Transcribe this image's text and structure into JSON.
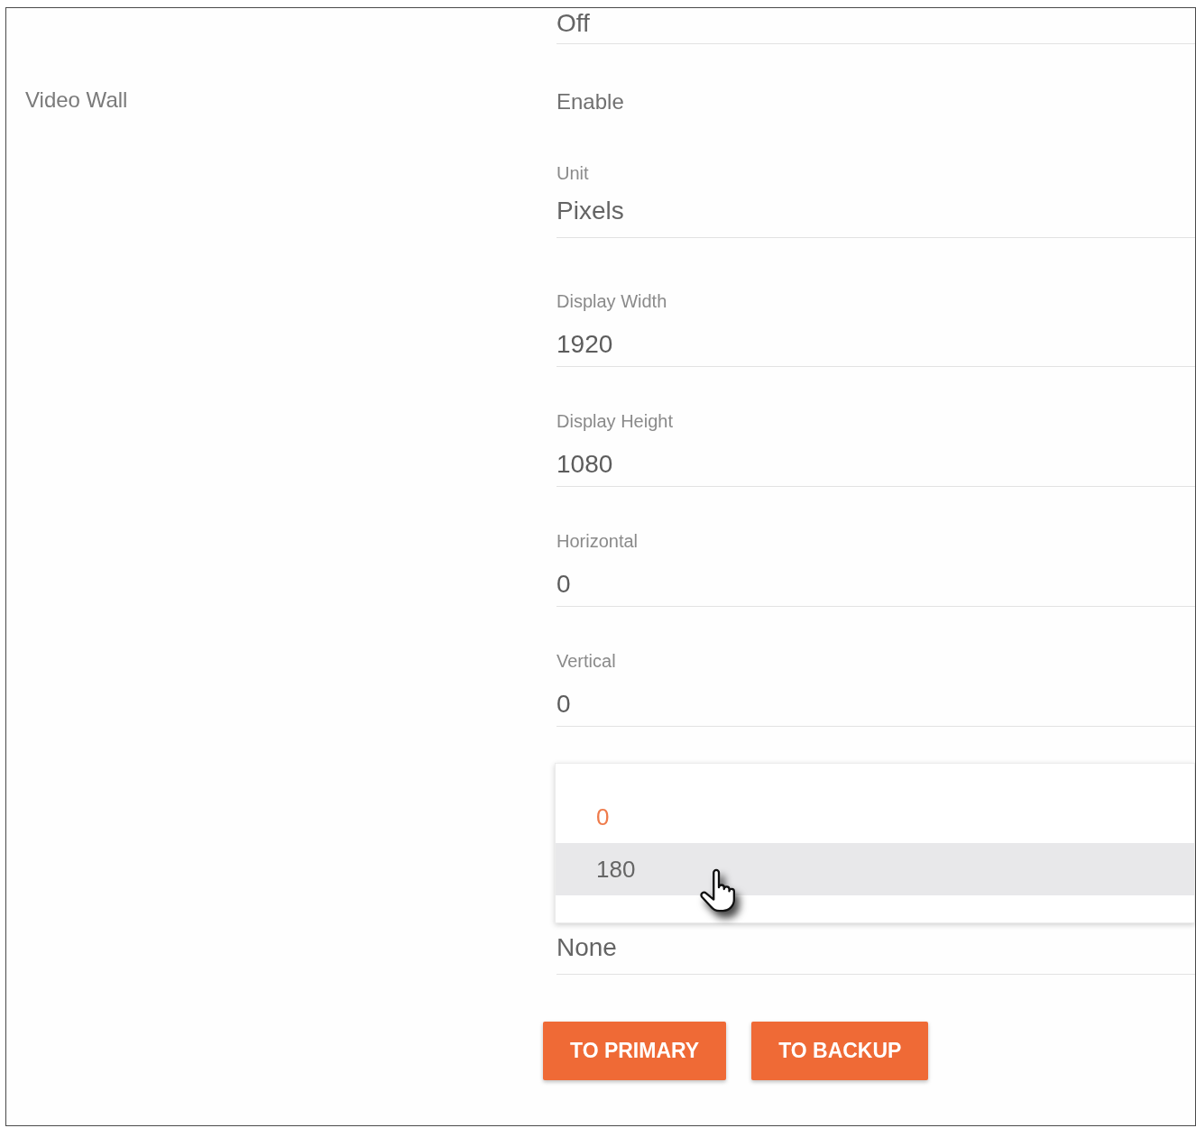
{
  "section": {
    "label": "Video Wall"
  },
  "fields": [
    {
      "kind": "select",
      "value": "Off"
    },
    {
      "kind": "text",
      "value": "Enable"
    },
    {
      "kind": "select",
      "label": "Unit",
      "value": "Pixels"
    },
    {
      "kind": "input",
      "label": "Display Width",
      "value": "1920"
    },
    {
      "kind": "input",
      "label": "Display Height",
      "value": "1080"
    },
    {
      "kind": "input",
      "label": "Horizontal",
      "value": "0"
    },
    {
      "kind": "input",
      "label": "Vertical",
      "value": "0"
    },
    {
      "kind": "menu",
      "options": [
        {
          "label": "0",
          "selected": true,
          "hovered": false
        },
        {
          "label": "180",
          "selected": false,
          "hovered": true
        }
      ]
    },
    {
      "kind": "select",
      "value": "None"
    }
  ],
  "buttons": [
    {
      "label": "TO PRIMARY"
    },
    {
      "label": "TO BACKUP"
    }
  ]
}
